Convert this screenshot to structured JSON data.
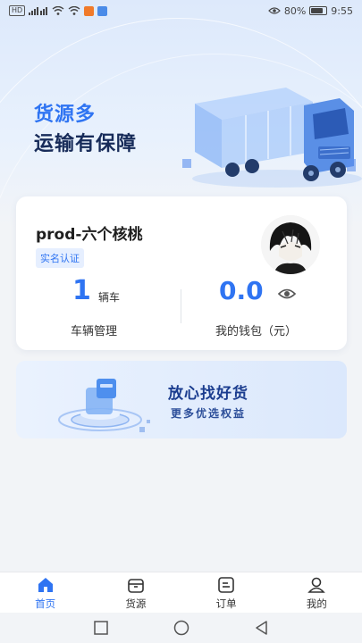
{
  "status_bar": {
    "network_label": "HD",
    "battery_text": "80%",
    "battery_level": 0.8,
    "time": "9:55"
  },
  "hero": {
    "title_line1": "货源多",
    "title_line2": "运输有保障"
  },
  "profile": {
    "name": "prod-六个核桃",
    "verified_badge": "实名认证",
    "vehicle_count": "1",
    "vehicle_unit": "辆车",
    "vehicle_label": "车辆管理",
    "wallet_amount": "0.0",
    "wallet_label": "我的钱包（元）"
  },
  "promo": {
    "title": "放心找好货",
    "subtitle": "更多优选权益"
  },
  "tabs": [
    {
      "label": "首页",
      "icon": "home-icon",
      "active": true
    },
    {
      "label": "货源",
      "icon": "cargo-icon",
      "active": false
    },
    {
      "label": "订单",
      "icon": "order-icon",
      "active": false
    },
    {
      "label": "我的",
      "icon": "user-icon",
      "active": false
    }
  ],
  "colors": {
    "accent": "#2f74f2",
    "dark_text": "#172b59"
  }
}
